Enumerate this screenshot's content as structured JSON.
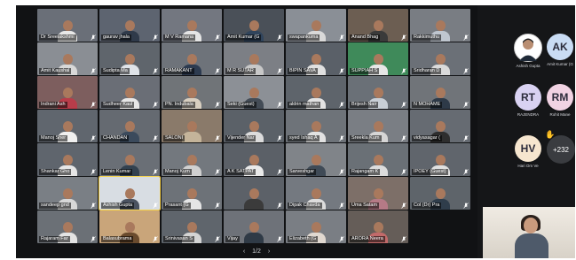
{
  "pager": {
    "prev": "‹",
    "label": "1/2",
    "next": "›"
  },
  "tiles": [
    {
      "name": "Dr Sreelakshmi",
      "bg": "#6a6f78",
      "shirt": "#e8e8e8"
    },
    {
      "name": "gaurav jhala",
      "bg": "#5d6470",
      "shirt": "#2f3a4a"
    },
    {
      "name": "M V Ramana",
      "bg": "#737780",
      "shirt": "#e5e5e5"
    },
    {
      "name": "Amit Kumar (G",
      "bg": "#4a5058",
      "shirt": "#30445c"
    },
    {
      "name": "swapankuma",
      "bg": "#8a8f96",
      "shirt": "#d9d9d9"
    },
    {
      "name": "Anand Bhag",
      "bg": "#6c5e52",
      "shirt": "#3a3a3a"
    },
    {
      "name": "Rakkimuthu",
      "bg": "#797d83",
      "shirt": "#bfc6cf"
    },
    {
      "name": "Amit Kaushal",
      "bg": "#8a8e94",
      "shirt": "#d8d8d8"
    },
    {
      "name": "Sudipta Ma",
      "bg": "#5f656c",
      "shirt": "#dfe3e8"
    },
    {
      "name": "RAMAKANT",
      "bg": "#6e737a",
      "shirt": "#2d3b50"
    },
    {
      "name": "M R SUTAR",
      "bg": "#7c7f85",
      "shirt": "#c8c8c8"
    },
    {
      "name": "BIPIN SAVA",
      "bg": "#5a6068",
      "shirt": "#e0e0e0"
    },
    {
      "name": "SUPPIAH S",
      "bg": "#3f8a5a",
      "shirt": "#e6e6e6"
    },
    {
      "name": "Sridharan D",
      "bg": "#6b7077",
      "shirt": "#dadada"
    },
    {
      "name": "Indrani Ash",
      "bg": "#7d5e5e",
      "shirt": "#b83d4a"
    },
    {
      "name": "Sudheer Kaul",
      "bg": "#6a6e76",
      "shirt": "#e7e7e7"
    },
    {
      "name": "PN. Indubala",
      "bg": "#707478",
      "shirt": "#d8cfc0"
    },
    {
      "name": "Seki (Guest)",
      "bg": "#8c9096",
      "shirt": "#444c56"
    },
    {
      "name": "aldrin mathan",
      "bg": "#5e646b",
      "shirt": "#e3e3e3"
    },
    {
      "name": "Brijesh Nair",
      "bg": "#6a7077",
      "shirt": "#c9cfd6"
    },
    {
      "name": "N MOHAME",
      "bg": "#707479",
      "shirt": "#2e3a48"
    },
    {
      "name": "Manoj Sher",
      "bg": "#60666e",
      "shirt": "#f0f0f0"
    },
    {
      "name": "CHANDAN",
      "bg": "#656a71",
      "shirt": "#3b4a5c"
    },
    {
      "name": "SALONI",
      "bg": "#8a7a6a",
      "shirt": "#c4b49a"
    },
    {
      "name": "Vijender Nar",
      "bg": "#5b6168",
      "shirt": "#dcdcdc"
    },
    {
      "name": "syed Ishaq A",
      "bg": "#6e7379",
      "shirt": "#e2e2e2"
    },
    {
      "name": "Sreekla Kum",
      "bg": "#7a7e84",
      "shirt": "#d6d6d6"
    },
    {
      "name": "vidyasagar (",
      "bg": "#666b72",
      "shirt": "#2e2e2e"
    },
    {
      "name": "Shankar Gho",
      "bg": "#5f656d",
      "shirt": "#e6e6e6"
    },
    {
      "name": "Lenin Kumar",
      "bg": "#6a6f76",
      "shirt": "#33414f"
    },
    {
      "name": "Manoj Kum",
      "bg": "#73787e",
      "shirt": "#d0d0d0"
    },
    {
      "name": "A K SATPAT",
      "bg": "#5b6067",
      "shirt": "#eaeaea"
    },
    {
      "name": "Sarveshgar",
      "bg": "#808489",
      "shirt": "#3f4a56"
    },
    {
      "name": "Rajangam K",
      "bg": "#6a7076",
      "shirt": "#dcdcdc"
    },
    {
      "name": "IPOEY (Guest)",
      "bg": "#60656c",
      "shirt": "#e0e0e0"
    },
    {
      "name": "sandeep gnd",
      "bg": "#7a7f85",
      "shirt": "#d8d8d8"
    },
    {
      "name": "Ashish Gupta",
      "bg": "#d8dde3",
      "shirt": "#4a5260",
      "highlight": true
    },
    {
      "name": "Prasant (G",
      "bg": "#6d7278",
      "shirt": "#e5e5e5"
    },
    {
      "name": "",
      "bg": "#5c6168",
      "shirt": "#3b3b3b"
    },
    {
      "name": "Dipak Chavda",
      "bg": "#747980",
      "shirt": "#dddddd"
    },
    {
      "name": "Uma Satam",
      "bg": "#7d6f68",
      "shirt": "#b57a86"
    },
    {
      "name": "Col (Dr) Pra",
      "bg": "#5e646a",
      "shirt": "#2f3d4b"
    },
    {
      "name": "Rajaram Far",
      "bg": "#6b7076",
      "shirt": "#e3e3e3"
    },
    {
      "name": "Balasubrama",
      "bg": "#c9a57a",
      "shirt": "#6a4b2e"
    },
    {
      "name": "Srinivasan S",
      "bg": "#5f656c",
      "shirt": "#d4d4d4"
    },
    {
      "name": "Vijay",
      "bg": "#6e7279",
      "shirt": "#2f3a46"
    },
    {
      "name": "Elizabeth (G",
      "bg": "#7a7e84",
      "shirt": "#e0d8d0"
    },
    {
      "name": "ARORA Neera",
      "bg": "#655d58",
      "shirt": "#c26a6a"
    }
  ],
  "attendees": [
    {
      "initials": "",
      "name": "Ashish Gupta",
      "color": "#ffffff",
      "photo": true
    },
    {
      "initials": "AK",
      "name": "Amit Kumar (G",
      "color": "#c9dcf4"
    },
    {
      "initials": "RT",
      "name": "RAJENDRA",
      "color": "#d9d2f2"
    },
    {
      "initials": "RM",
      "name": "Rohit Mane",
      "color": "#f1d3e3"
    },
    {
      "initials": "HV",
      "name": "Hari Om Ve",
      "color": "#f6e6cf"
    }
  ],
  "more_count": "+232",
  "hand_icon": "raised-hand"
}
